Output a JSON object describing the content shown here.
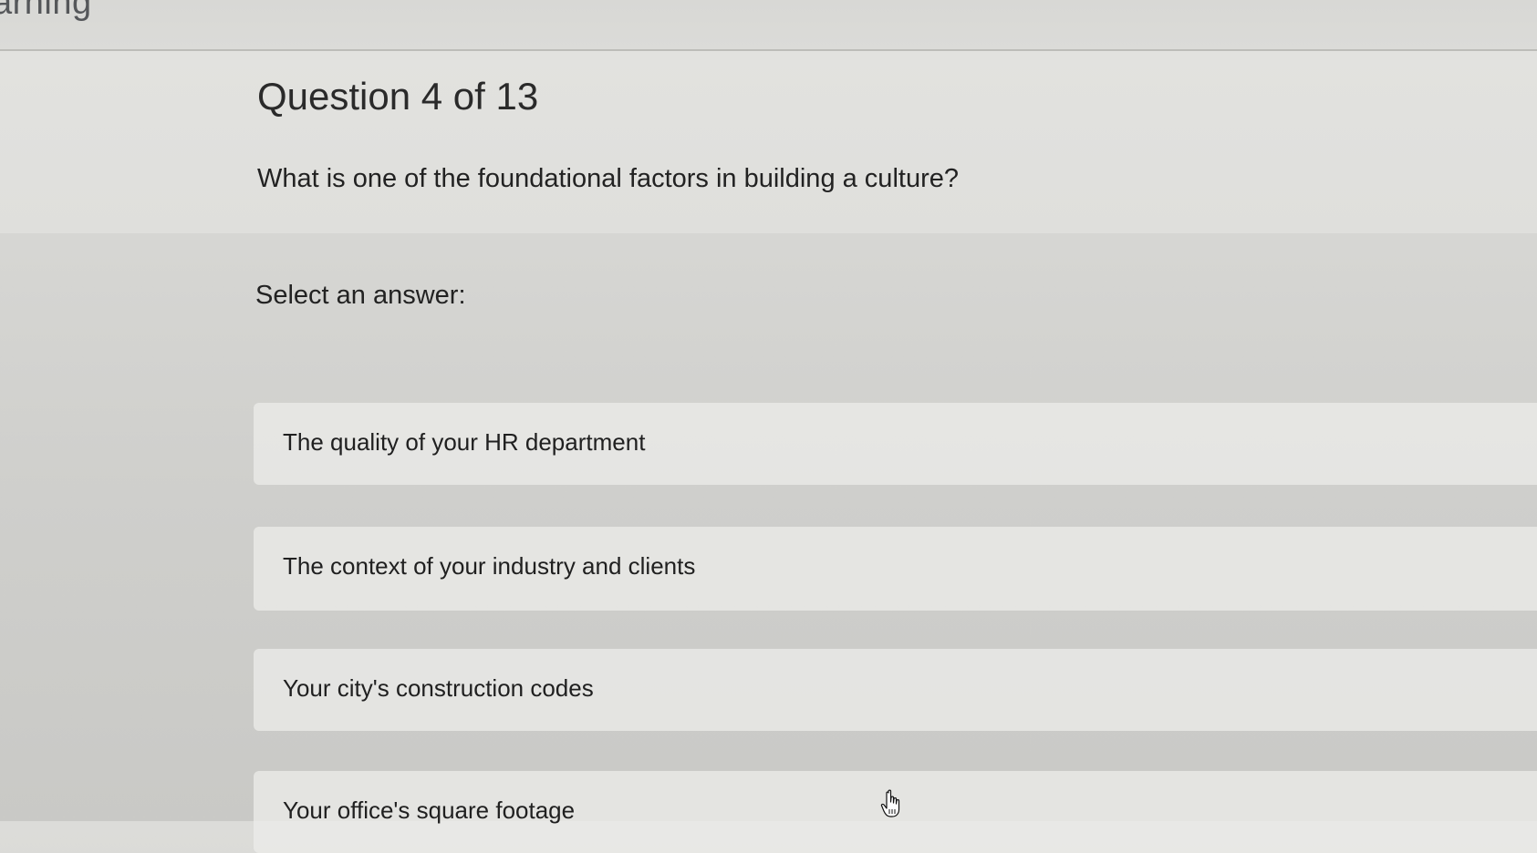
{
  "header": {
    "app_title": "arning"
  },
  "question": {
    "counter": "Question 4 of 13",
    "text": "What is one of the foundational factors in building a culture?",
    "prompt": "Select an answer:"
  },
  "answers": [
    {
      "label": "The quality of your HR department"
    },
    {
      "label": "The context of your industry and clients"
    },
    {
      "label": "Your city's construction codes"
    },
    {
      "label": "Your office's square footage"
    }
  ],
  "icons": {
    "cursor": "hand-pointer-icon"
  }
}
